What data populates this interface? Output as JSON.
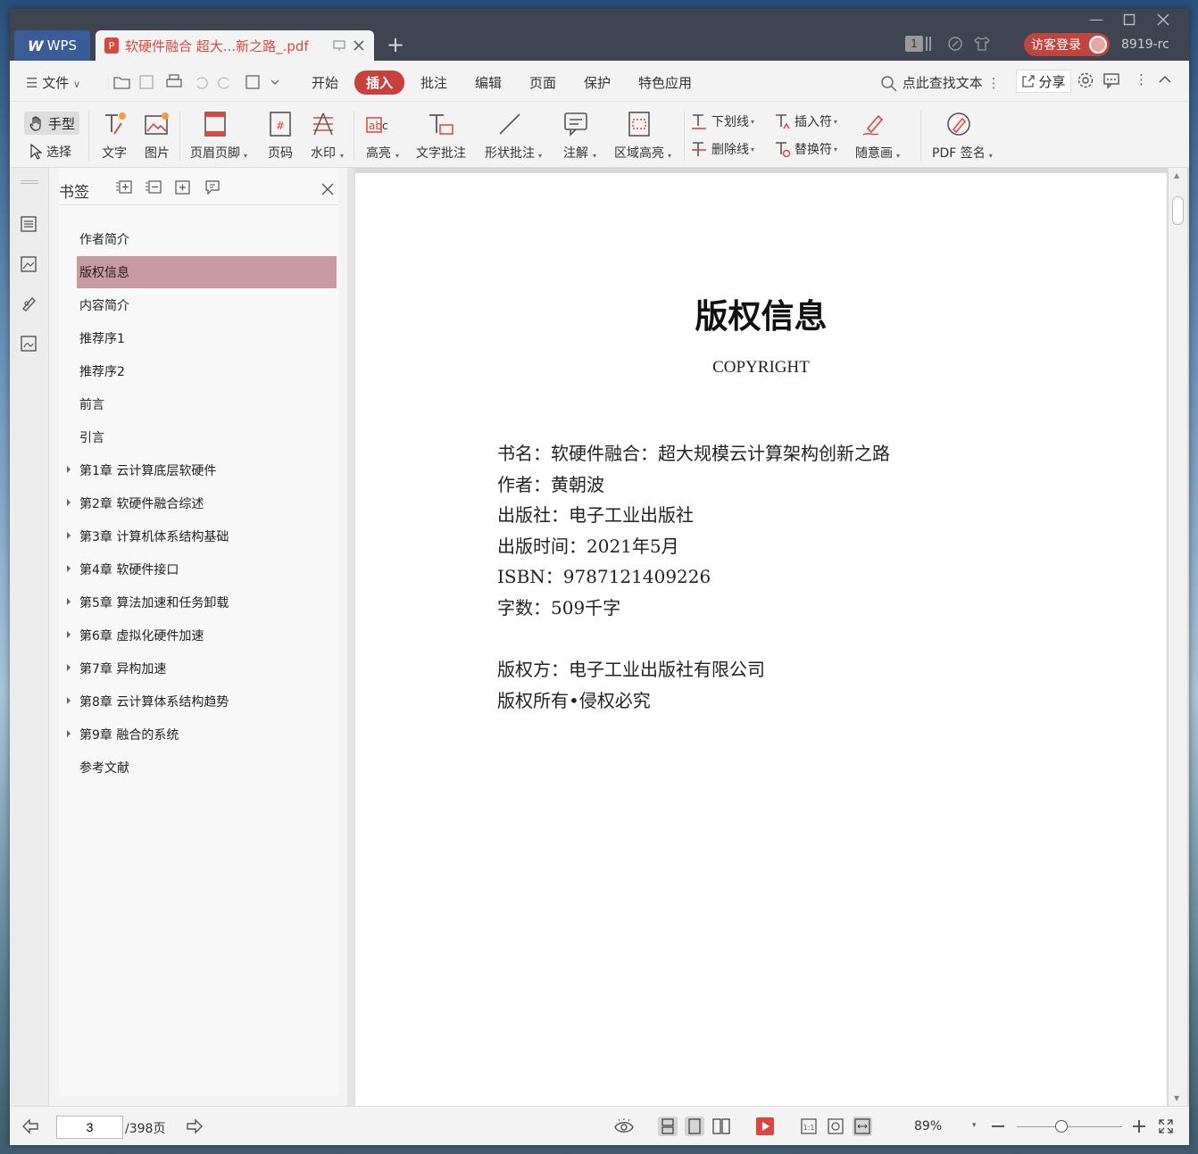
{
  "titlebar": {
    "app_tab": "WPS",
    "doc_tab": "软硬件融合 超大...新之路_.pdf",
    "badge": "1",
    "login": "访客登录",
    "user_id": "8919-rc"
  },
  "menu": {
    "file": "文件",
    "items": [
      "开始",
      "插入",
      "批注",
      "编辑",
      "页面",
      "保护",
      "特色应用"
    ],
    "search": "点此查找文本",
    "share": "分享"
  },
  "ribbon": {
    "hand": "手型",
    "select": "选择",
    "text": "文字",
    "image": "图片",
    "header_footer": "页眉页脚",
    "page_number": "页码",
    "watermark": "水印",
    "highlight": "高亮",
    "text_comment": "文字批注",
    "shape_comment": "形状批注",
    "note": "注解",
    "area_highlight": "区域高亮",
    "underline": "下划线",
    "strikethrough": "删除线",
    "insert_mark": "插入符",
    "replace_mark": "替换符",
    "freehand": "随意画",
    "pdf_sign": "PDF 签名"
  },
  "bookmark_panel": {
    "title": "书签",
    "items": [
      {
        "label": "作者简介"
      },
      {
        "label": "版权信息"
      },
      {
        "label": "内容简介"
      },
      {
        "label": "推荐序1"
      },
      {
        "label": "推荐序2"
      },
      {
        "label": "前言"
      },
      {
        "label": "引言"
      },
      {
        "label": "第1章 云计算底层软硬件"
      },
      {
        "label": "第2章 软硬件融合综述"
      },
      {
        "label": "第3章 计算机体系结构基础"
      },
      {
        "label": "第4章 软硬件接口"
      },
      {
        "label": "第5章 算法加速和任务卸载"
      },
      {
        "label": "第6章 虚拟化硬件加速"
      },
      {
        "label": "第7章 异构加速"
      },
      {
        "label": "第8章 云计算体系结构趋势"
      },
      {
        "label": "第9章 融合的系统"
      },
      {
        "label": "参考文献"
      }
    ]
  },
  "page": {
    "title": "版权信息",
    "subtitle": "COPYRIGHT",
    "lines": [
      "书名：软硬件融合：超大规模云计算架构创新之路",
      "作者：黄朝波",
      "出版社：电子工业出版社",
      "出版时间：2021年5月",
      "ISBN：9787121409226",
      "字数：509千字",
      "版权方：电子工业出版社有限公司",
      "版权所有•侵权必究"
    ]
  },
  "status": {
    "current_page": "3",
    "total_pages": "/398页",
    "zoom": "89%"
  }
}
